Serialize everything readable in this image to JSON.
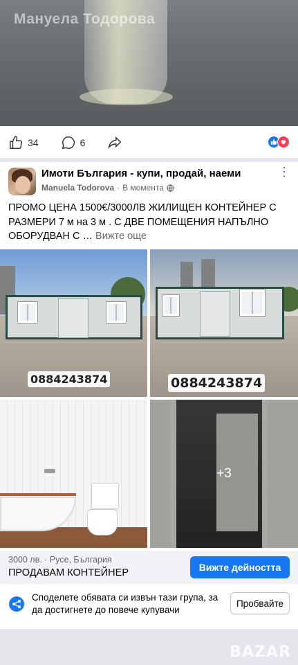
{
  "top_photo": {
    "watermark_name": "Мануела Тодорова"
  },
  "reactions": {
    "like_count": "34",
    "comment_count": "6",
    "summary_colors": {
      "like": "#1877f2",
      "love": "#f33e58"
    }
  },
  "post": {
    "group_name": "Имоти България - купи, продай, наеми",
    "author": "Manuela Todorova",
    "separator": "·",
    "time": "В момента",
    "privacy_icon": "globe-icon",
    "more_icon": "ellipsis-icon",
    "text": "ПРОМО ЦЕНА 1500€/3000ЛВ ЖИЛИЩЕН КОНТЕЙНЕР С РАЗМЕРИ 7 м на 3 м . С ДВЕ ПОМЕЩЕНИЯ НАПЪЛНО ОБОРУДВАН С …",
    "see_more": "Вижте още"
  },
  "photos": {
    "phone_1": "0884243874",
    "phone_2": "0884243874",
    "more_count": "+3"
  },
  "listing": {
    "price_location": "3000 лв. · Русе, България",
    "title": "ПРОДАВАМ КОНТЕЙНЕР",
    "cta": "Вижте дейността",
    "accent": "#1877f2"
  },
  "share": {
    "text": "Споделете обявата си извън тази група, за да достигнете до повече купувачи",
    "button": "Пробвайте"
  },
  "watermark": {
    "logo": "BAZAR"
  }
}
